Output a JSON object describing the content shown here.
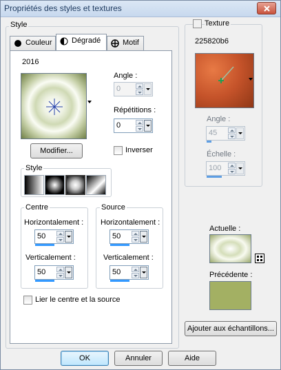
{
  "window": {
    "title": "Propriétés des styles et textures"
  },
  "style": {
    "group_label": "Style",
    "tabs": [
      {
        "label": "Couleur",
        "icon": "filled-circle-icon"
      },
      {
        "label": "Dégradé",
        "icon": "half-circle-icon",
        "active": true
      },
      {
        "label": "Motif",
        "icon": "pattern-icon"
      }
    ],
    "gradient_name": "2016",
    "angle": {
      "label": "Angle :",
      "value": "0",
      "enabled": false
    },
    "repetitions": {
      "label": "Répétitions :",
      "value": "0"
    },
    "modify_button": "Modifier...",
    "invert": {
      "label": "Inverser",
      "checked": false
    },
    "style_group": {
      "label": "Style",
      "selected_index": 2,
      "options": [
        "linear-style-icon",
        "rectangular-style-icon",
        "sunburst-style-icon",
        "radial-style-icon"
      ]
    },
    "centre": {
      "label": "Centre",
      "horizontal": {
        "label": "Horizontalement :",
        "value": "50",
        "fill": 0.5
      },
      "vertical": {
        "label": "Verticalement :",
        "value": "50",
        "fill": 0.5
      }
    },
    "source": {
      "label": "Source",
      "horizontal": {
        "label": "Horizontalement :",
        "value": "50",
        "fill": 0.5
      },
      "vertical": {
        "label": "Verticalement :",
        "value": "50",
        "fill": 0.5
      }
    },
    "link": {
      "label": "Lier le centre et la source",
      "checked": false
    }
  },
  "texture": {
    "label": "Texture",
    "checked": false,
    "name": "225820b6",
    "angle": {
      "label": "Angle :",
      "value": "45",
      "enabled": false,
      "fill": 0.125
    },
    "scale": {
      "label": "Échelle :",
      "value": "100",
      "enabled": false,
      "fill": 0.4
    }
  },
  "preview": {
    "current_label": "Actuelle :",
    "previous_label": "Précédente :",
    "previous_color": "#a3b063"
  },
  "add_swatch_button": "Ajouter aux échantillons...",
  "footer": {
    "ok": "OK",
    "cancel": "Annuler",
    "help": "Aide"
  }
}
